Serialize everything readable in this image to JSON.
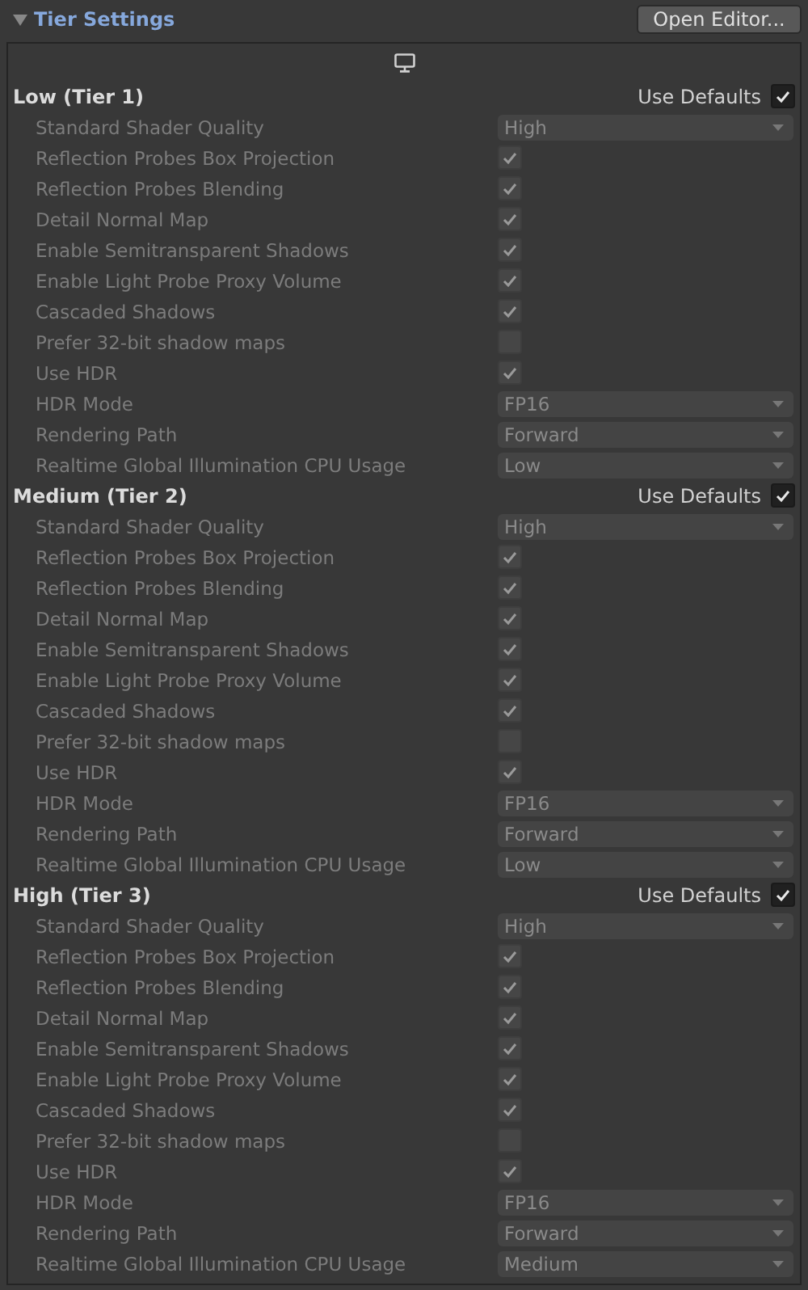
{
  "section": {
    "title": "Tier Settings",
    "expanded": true,
    "button": "Open Editor..."
  },
  "tiers": [
    {
      "name": "Low (Tier 1)",
      "defaults_label": "Use Defaults",
      "use_defaults": true,
      "settings": [
        {
          "label": "Standard Shader Quality",
          "kind": "dropdown",
          "value": "High"
        },
        {
          "label": "Reflection Probes Box Projection",
          "kind": "checkbox",
          "checked": true
        },
        {
          "label": "Reflection Probes Blending",
          "kind": "checkbox",
          "checked": true
        },
        {
          "label": "Detail Normal Map",
          "kind": "checkbox",
          "checked": true
        },
        {
          "label": "Enable Semitransparent Shadows",
          "kind": "checkbox",
          "checked": true
        },
        {
          "label": "Enable Light Probe Proxy Volume",
          "kind": "checkbox",
          "checked": true
        },
        {
          "label": "Cascaded Shadows",
          "kind": "checkbox",
          "checked": true
        },
        {
          "label": "Prefer 32-bit shadow maps",
          "kind": "checkbox",
          "checked": false
        },
        {
          "label": "Use HDR",
          "kind": "checkbox",
          "checked": true
        },
        {
          "label": "HDR Mode",
          "kind": "dropdown",
          "value": "FP16"
        },
        {
          "label": "Rendering Path",
          "kind": "dropdown",
          "value": "Forward"
        },
        {
          "label": "Realtime Global Illumination CPU Usage",
          "kind": "dropdown",
          "value": "Low"
        }
      ]
    },
    {
      "name": "Medium (Tier 2)",
      "defaults_label": "Use Defaults",
      "use_defaults": true,
      "settings": [
        {
          "label": "Standard Shader Quality",
          "kind": "dropdown",
          "value": "High"
        },
        {
          "label": "Reflection Probes Box Projection",
          "kind": "checkbox",
          "checked": true
        },
        {
          "label": "Reflection Probes Blending",
          "kind": "checkbox",
          "checked": true
        },
        {
          "label": "Detail Normal Map",
          "kind": "checkbox",
          "checked": true
        },
        {
          "label": "Enable Semitransparent Shadows",
          "kind": "checkbox",
          "checked": true
        },
        {
          "label": "Enable Light Probe Proxy Volume",
          "kind": "checkbox",
          "checked": true
        },
        {
          "label": "Cascaded Shadows",
          "kind": "checkbox",
          "checked": true
        },
        {
          "label": "Prefer 32-bit shadow maps",
          "kind": "checkbox",
          "checked": false
        },
        {
          "label": "Use HDR",
          "kind": "checkbox",
          "checked": true
        },
        {
          "label": "HDR Mode",
          "kind": "dropdown",
          "value": "FP16"
        },
        {
          "label": "Rendering Path",
          "kind": "dropdown",
          "value": "Forward"
        },
        {
          "label": "Realtime Global Illumination CPU Usage",
          "kind": "dropdown",
          "value": "Low"
        }
      ]
    },
    {
      "name": "High (Tier 3)",
      "defaults_label": "Use Defaults",
      "use_defaults": true,
      "settings": [
        {
          "label": "Standard Shader Quality",
          "kind": "dropdown",
          "value": "High"
        },
        {
          "label": "Reflection Probes Box Projection",
          "kind": "checkbox",
          "checked": true
        },
        {
          "label": "Reflection Probes Blending",
          "kind": "checkbox",
          "checked": true
        },
        {
          "label": "Detail Normal Map",
          "kind": "checkbox",
          "checked": true
        },
        {
          "label": "Enable Semitransparent Shadows",
          "kind": "checkbox",
          "checked": true
        },
        {
          "label": "Enable Light Probe Proxy Volume",
          "kind": "checkbox",
          "checked": true
        },
        {
          "label": "Cascaded Shadows",
          "kind": "checkbox",
          "checked": true
        },
        {
          "label": "Prefer 32-bit shadow maps",
          "kind": "checkbox",
          "checked": false
        },
        {
          "label": "Use HDR",
          "kind": "checkbox",
          "checked": true
        },
        {
          "label": "HDR Mode",
          "kind": "dropdown",
          "value": "FP16"
        },
        {
          "label": "Rendering Path",
          "kind": "dropdown",
          "value": "Forward"
        },
        {
          "label": "Realtime Global Illumination CPU Usage",
          "kind": "dropdown",
          "value": "Medium"
        }
      ]
    }
  ]
}
